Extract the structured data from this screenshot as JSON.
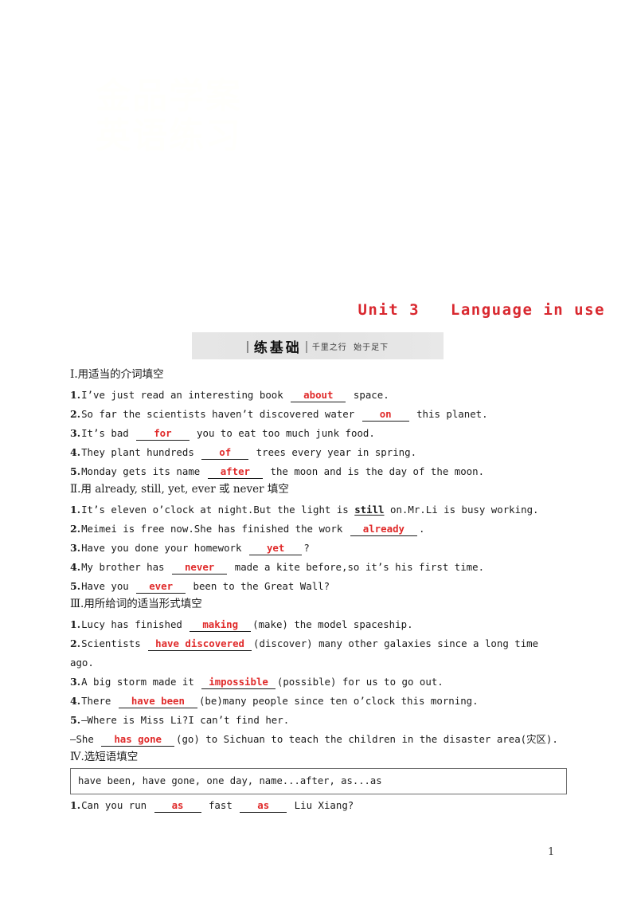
{
  "page": {
    "watermark_text": "金品学案\n英语练习",
    "page_number": "1"
  },
  "unit_title": "Unit 3   Language in use",
  "banner": {
    "main_label": "练基础",
    "sub_label": "千里之行  始于足下"
  },
  "sections": [
    {
      "heading_prefix": "Ⅰ.",
      "heading_text": "用适当的介词填空",
      "items": [
        {
          "num": "1.",
          "parts": [
            {
              "type": "text",
              "text": "I’ve just read an interesting book "
            },
            {
              "type": "blank",
              "text": "about"
            },
            {
              "type": "text",
              "text": " space."
            }
          ]
        },
        {
          "num": "2.",
          "parts": [
            {
              "type": "text",
              "text": "So far the scientists haven’t discovered water "
            },
            {
              "type": "blank",
              "text": "on"
            },
            {
              "type": "text",
              "text": " this planet."
            }
          ]
        },
        {
          "num": "3.",
          "parts": [
            {
              "type": "text",
              "text": "It’s bad "
            },
            {
              "type": "blank",
              "text": "for"
            },
            {
              "type": "text",
              "text": " you to eat too much junk food."
            }
          ]
        },
        {
          "num": "4.",
          "parts": [
            {
              "type": "text",
              "text": "They plant hundreds "
            },
            {
              "type": "blank",
              "text": "of"
            },
            {
              "type": "text",
              "text": " trees every year in spring."
            }
          ]
        },
        {
          "num": "5.",
          "parts": [
            {
              "type": "text",
              "text": "Monday gets its name "
            },
            {
              "type": "blank",
              "text": "after"
            },
            {
              "type": "text",
              "text": " the moon and is the day of the moon."
            }
          ]
        }
      ]
    },
    {
      "heading_prefix": "Ⅱ.",
      "heading_text": "用 already, still, yet, ever 或 never 填空",
      "items": [
        {
          "num": "1.",
          "parts": [
            {
              "type": "text",
              "text": "It’s eleven o’clock at night.But the light is "
            },
            {
              "type": "underline",
              "text": "still"
            },
            {
              "type": "text",
              "text": " on.Mr.Li is busy working."
            }
          ]
        },
        {
          "num": "2.",
          "parts": [
            {
              "type": "text",
              "text": "Meimei is free now.She has finished the work "
            },
            {
              "type": "blank",
              "text": "already"
            },
            {
              "type": "text",
              "text": "."
            }
          ]
        },
        {
          "num": "3.",
          "parts": [
            {
              "type": "text",
              "text": "Have you done your homework "
            },
            {
              "type": "blank",
              "text": "yet"
            },
            {
              "type": "text",
              "text": "?"
            }
          ]
        },
        {
          "num": "4.",
          "parts": [
            {
              "type": "text",
              "text": "My brother has "
            },
            {
              "type": "blank",
              "text": "never"
            },
            {
              "type": "text",
              "text": " made a kite before,so it’s his first time."
            }
          ]
        },
        {
          "num": "5.",
          "parts": [
            {
              "type": "text",
              "text": "Have you "
            },
            {
              "type": "blank",
              "text": "ever"
            },
            {
              "type": "text",
              "text": " been to the Great Wall?"
            }
          ]
        }
      ]
    },
    {
      "heading_prefix": "Ⅲ.",
      "heading_text": "用所给词的适当形式填空",
      "items": [
        {
          "num": "1.",
          "parts": [
            {
              "type": "text",
              "text": "Lucy has finished "
            },
            {
              "type": "blank",
              "text": "making"
            },
            {
              "type": "text",
              "text": "(make) the model spaceship."
            }
          ]
        },
        {
          "num": "2.",
          "parts": [
            {
              "type": "text",
              "text": "Scientists "
            },
            {
              "type": "blank",
              "text": "have discovered"
            },
            {
              "type": "text",
              "text": "(discover) many other galaxies since a long time ago."
            }
          ]
        },
        {
          "num": "3.",
          "parts": [
            {
              "type": "text",
              "text": "A big storm made it "
            },
            {
              "type": "blank",
              "text": "impossible"
            },
            {
              "type": "text",
              "text": "(possible) for us to go out."
            }
          ]
        },
        {
          "num": "4.",
          "parts": [
            {
              "type": "text",
              "text": "There "
            },
            {
              "type": "blank",
              "text": "have been"
            },
            {
              "type": "text",
              "text": "(be)many people since ten o’clock this morning."
            }
          ]
        },
        {
          "num": "5.",
          "parts": [
            {
              "type": "text",
              "text": "—Where is Miss Li?I can’t find her."
            }
          ]
        },
        {
          "num": "",
          "parts": [
            {
              "type": "text",
              "text": "—She "
            },
            {
              "type": "blank",
              "text": "has gone"
            },
            {
              "type": "text",
              "text": "(go) to Sichuan to teach the children in the disaster area(灾区)."
            }
          ]
        }
      ]
    },
    {
      "heading_prefix": "Ⅳ.",
      "heading_text": "选短语填空",
      "phrase_bank": "have been, have gone, one day, name...after, as...as",
      "items": [
        {
          "num": "1.",
          "parts": [
            {
              "type": "text",
              "text": "Can you run "
            },
            {
              "type": "blank",
              "text": "as"
            },
            {
              "type": "text",
              "text": " fast "
            },
            {
              "type": "blank",
              "text": "as"
            },
            {
              "type": "text",
              "text": " Liu Xiang?"
            }
          ]
        }
      ]
    }
  ]
}
